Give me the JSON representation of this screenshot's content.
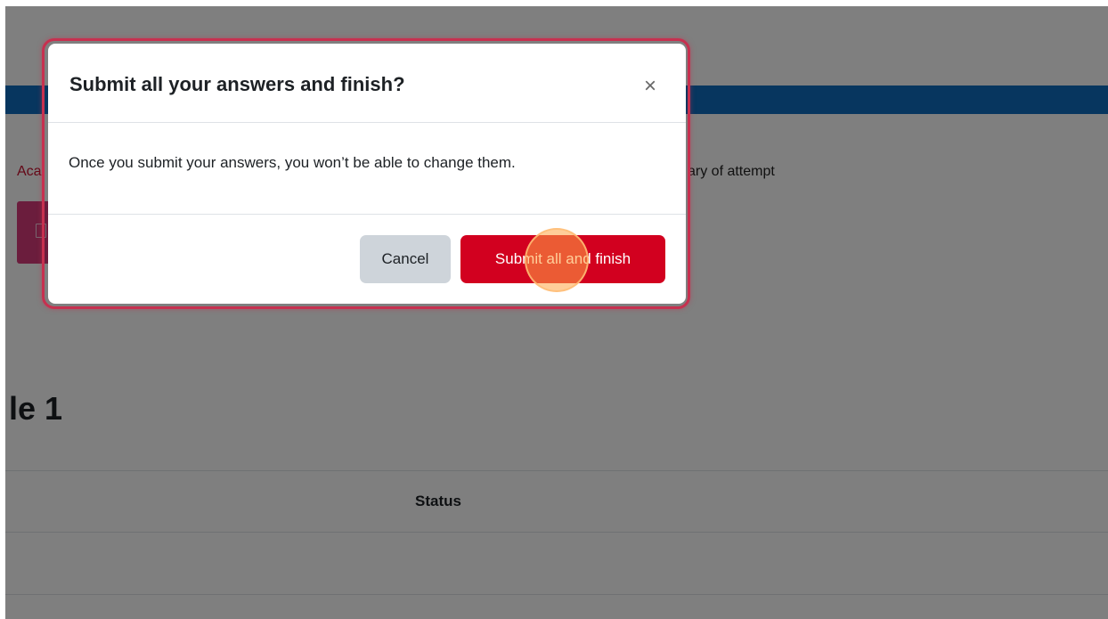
{
  "background": {
    "breadcrumb_partial": "Aca",
    "breadcrumb_right": "ary of attempt",
    "page_heading": "le 1",
    "table": {
      "status_header": "Status"
    }
  },
  "modal": {
    "title": "Submit all your answers and finish?",
    "close_symbol": "×",
    "message": "Once you submit your answers, you won’t be able to change them.",
    "cancel_label": "Cancel",
    "submit_label": "Submit all and finish"
  },
  "colors": {
    "navbar": "#0f6cbf",
    "primary_danger": "#d2001f",
    "secondary_button": "#ced4da",
    "highlight_outline": "#c7304f",
    "breadcrumb_link": "#c8102e"
  },
  "icons": {
    "close": "close-icon",
    "quiz_nav": "document-icon"
  }
}
